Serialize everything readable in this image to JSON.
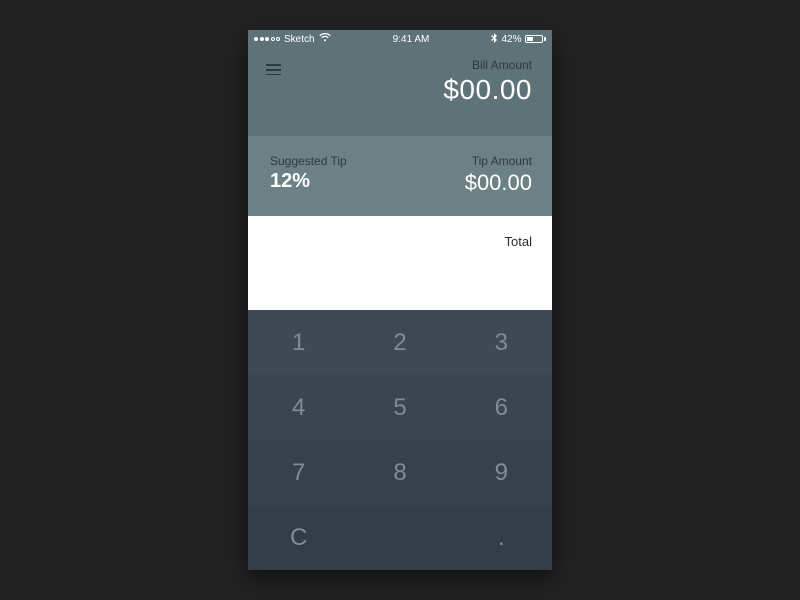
{
  "status_bar": {
    "carrier": "Sketch",
    "time": "9:41 AM",
    "battery_pct": "42%"
  },
  "bill": {
    "label": "Bill Amount",
    "amount": "$00.00"
  },
  "tip": {
    "suggested_label": "Suggested Tip",
    "suggested_pct": "12%",
    "amount_label": "Tip Amount",
    "amount": "$00.00"
  },
  "total": {
    "label": "Total"
  },
  "keypad": {
    "k1": "1",
    "k2": "2",
    "k3": "3",
    "k4": "4",
    "k5": "5",
    "k6": "6",
    "k7": "7",
    "k8": "8",
    "k9": "9",
    "kc": "C",
    "kdot": "."
  }
}
